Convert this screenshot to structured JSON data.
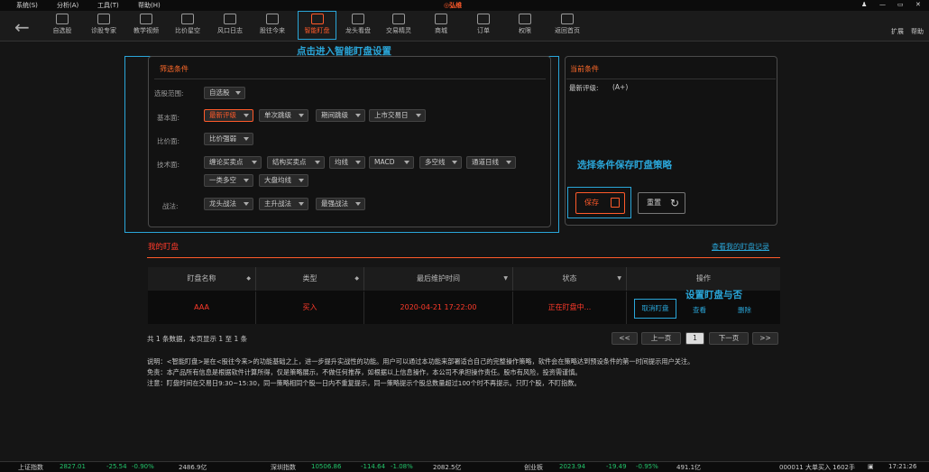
{
  "menubar": {
    "items": [
      "系统(S)",
      "分析(A)",
      "工具(T)",
      "帮助(H)"
    ],
    "logo": "弘维"
  },
  "toolbar": {
    "back": "←",
    "items": [
      "自选股",
      "诊股专家",
      "教学视频",
      "比价星空",
      "风口日志",
      "股往今来",
      "智能盯盘",
      "龙头看盘",
      "交易精灵",
      "商城",
      "订单",
      "权限",
      "返回首页"
    ],
    "right": [
      "扩展",
      "帮助"
    ]
  },
  "annotations": {
    "enter": "点击进入智能盯盘设置",
    "save": "选择条件保存盯盘策略",
    "toggle": "设置盯盘与否"
  },
  "filter": {
    "title": "筛选条件",
    "scope_label": "选股范围:",
    "scope": "自选股",
    "basic_label": "基本面:",
    "basic": [
      "最新评级",
      "单次跳级",
      "期间跳级",
      "上市交易日"
    ],
    "compare_label": "比价面:",
    "compare": [
      "比价强弱"
    ],
    "tech_label": "技术面:",
    "tech": [
      "缠论买卖点",
      "结构买卖点",
      "均线",
      "MACD",
      "多空线",
      "通道日线",
      "一类多空",
      "大盘均线"
    ],
    "tactic_label": "战法:",
    "tactic": [
      "龙头战法",
      "主升战法",
      "最强战法"
    ]
  },
  "current": {
    "title": "当前条件",
    "rating_label": "最新评级:",
    "rating_value": "(A+)",
    "save": "保存",
    "reset": "重置"
  },
  "mine": {
    "title": "我的盯盘",
    "link": "查看我的盯盘记录",
    "headers": [
      "盯盘名称",
      "类型",
      "最后维护时间",
      "状态",
      "操作"
    ],
    "row": {
      "name": "AAA",
      "type": "买入",
      "time": "2020-04-21 17:22:00",
      "status": "正在盯盘中...",
      "cancel": "取消盯盘",
      "view": "查看",
      "delete": "删除"
    }
  },
  "pager": {
    "summary": "共 1 条数据，本页显示 1 至 1 条",
    "first": "<<",
    "prev": "上一页",
    "page": "1",
    "next": "下一页",
    "last": ">>"
  },
  "notes": [
    "说明：<智能盯盘>是在<股往今来>的功能基础之上，进一步提升实战性的功能。用户可以通过本功能来部署适合自己的完整操作策略，软件会在策略达到预设条件的第一时间提示用户关注。",
    "免责：本产品所有信息是根据软件计算所得，仅是策略展示，不做任何推荐，如根据以上信息操作，本公司不承担操作责任。股市有风险，投资需谨慎。",
    "注意：盯盘时间在交易日9:30~15:30，同一策略相同个股一日内不重复提示，同一策略提示个股总数量超过100个时不再提示。只盯个股，不盯指数。"
  ],
  "statusbar": {
    "sh": [
      "上证指数",
      "2827.01",
      "-25.54",
      "-0.90%",
      "2486.9亿"
    ],
    "sz": [
      "深圳指数",
      "10506.86",
      "-114.64",
      "-1.08%",
      "2082.5亿"
    ],
    "cy": [
      "创业板",
      "2023.94",
      "-19.49",
      "-0.95%",
      "491.1亿"
    ],
    "ticker": "000011 大单买入 1602手",
    "time": "17:21:26"
  },
  "colors": {
    "accent": "#ff5a2a",
    "highlight": "#2aa6d9",
    "down": "#22c46a"
  }
}
